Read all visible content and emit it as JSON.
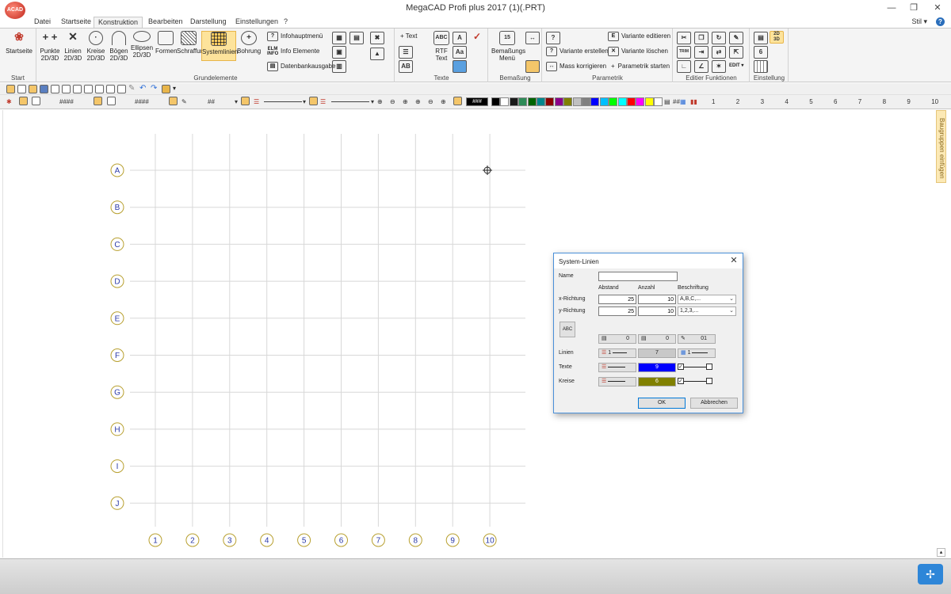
{
  "window": {
    "title": "MegaCAD Profi plus 2017 (1)(.PRT)",
    "logo_text": "ACAD"
  },
  "menu": {
    "tabs": [
      "Datei",
      "Startseite",
      "Konstruktion",
      "Bearbeiten",
      "Darstellung",
      "Einstellungen",
      "?"
    ],
    "active": "Konstruktion",
    "style_label": "Stil",
    "style_arrow": "▾",
    "help": "?"
  },
  "ribbon": {
    "groups": {
      "start": "Start",
      "grundelemente": "Grundelemente",
      "texte": "Texte",
      "bemassung": "Bemaßung",
      "parametrik": "Parametrik",
      "editier": "Editier Funktionen",
      "einstellung": "Einstellung"
    },
    "buttons": {
      "startseite": "Startseite",
      "punkte": "Punkte",
      "punkte_sub": "2D/3D",
      "linien": "Linien",
      "linien_sub": "2D/3D",
      "kreise": "Kreise",
      "kreise_sub": "2D/3D",
      "boegen": "Bögen",
      "boegen_sub": "2D/3D",
      "ellipsen": "Ellipsen",
      "ellipsen_sub": "2D/3D",
      "formen": "Formen",
      "schraffur": "Schraffur",
      "systemlinien": "Systemlinien",
      "bohrung": "Bohrung",
      "infohauptmenu": "Infohauptmenü",
      "info_elemente": "Info Elemente",
      "datenbankausgabe": "Datenbankausgabe",
      "text": "Text",
      "rtf": "RTF",
      "rtf_sub": "Text",
      "bemassungs_menu": "Bemaßungs",
      "bemassungs_menu_sub": "Menü",
      "variante_erstellen": "Variante erstellen",
      "mass_korrigieren": "Mass korrigieren",
      "variante_editieren": "Variante editieren",
      "variante_loeschen": "Variante löschen",
      "parametrik_starten": "Parametrik starten"
    },
    "icon_text": {
      "elm_info": "ELM",
      "elm_info_sub": "INFO",
      "edit": "EDIT",
      "trim": "TRIM",
      "twod_threed": "2D",
      "twod_threed_sub": "3D",
      "fifteen": "15"
    }
  },
  "toolbar2": {
    "hash1": "####",
    "hash2": "####",
    "hash3": "##",
    "hash4": "###",
    "hash5": "##",
    "layers": [
      "1",
      "2",
      "3",
      "4",
      "5",
      "6",
      "7",
      "8",
      "9",
      "10"
    ],
    "colors": [
      "#000000",
      "#ffffff",
      "#1a1a1a",
      "#2e8b57",
      "#006400",
      "#00868b",
      "#8b0000",
      "#8b008b",
      "#808000",
      "#c0c0c0",
      "#808080",
      "#0000ff",
      "#00bfff",
      "#00ff00",
      "#00ffff",
      "#ff0000",
      "#ff00ff",
      "#ffff00",
      "#ffffff"
    ]
  },
  "canvas": {
    "row_labels": [
      "A",
      "B",
      "C",
      "D",
      "E",
      "F",
      "G",
      "H",
      "I",
      "J"
    ],
    "col_labels": [
      "1",
      "2",
      "3",
      "4",
      "5",
      "6",
      "7",
      "8",
      "9",
      "10"
    ],
    "grid_line_color": "#d8d8d8",
    "bubble_color": "#b8a030",
    "label_color": "#2b3aa8"
  },
  "side_panel": {
    "label": "Baugruppen einfügen"
  },
  "dialog": {
    "title": "System-Linien",
    "close": "✕",
    "name_label": "Name",
    "name_value": "",
    "col_abstand": "Abstand",
    "col_anzahl": "Anzahl",
    "col_beschriftung": "Beschriftung",
    "x_label": "x-Richtung",
    "x_abstand": "25",
    "x_anzahl": "10",
    "x_beschriftung": "A,B,C,...",
    "y_label": "y-Richtung",
    "y_abstand": "25",
    "y_anzahl": "10",
    "y_beschriftung": "1,2,3,...",
    "row_top": {
      "v1": "0",
      "v2": "0",
      "v3": "01"
    },
    "linien_label": "Linien",
    "linien_style": "1",
    "linien_color": "7",
    "linien_extra": "1",
    "texte_label": "Texte",
    "texte_color": "9",
    "texte_color_hex": "#0000ff",
    "kreise_label": "Kreise",
    "kreise_color": "6",
    "kreise_color_hex": "#808000",
    "ok": "OK",
    "cancel": "Abbrechen",
    "check": "✓",
    "abc_icon": "ABC"
  }
}
